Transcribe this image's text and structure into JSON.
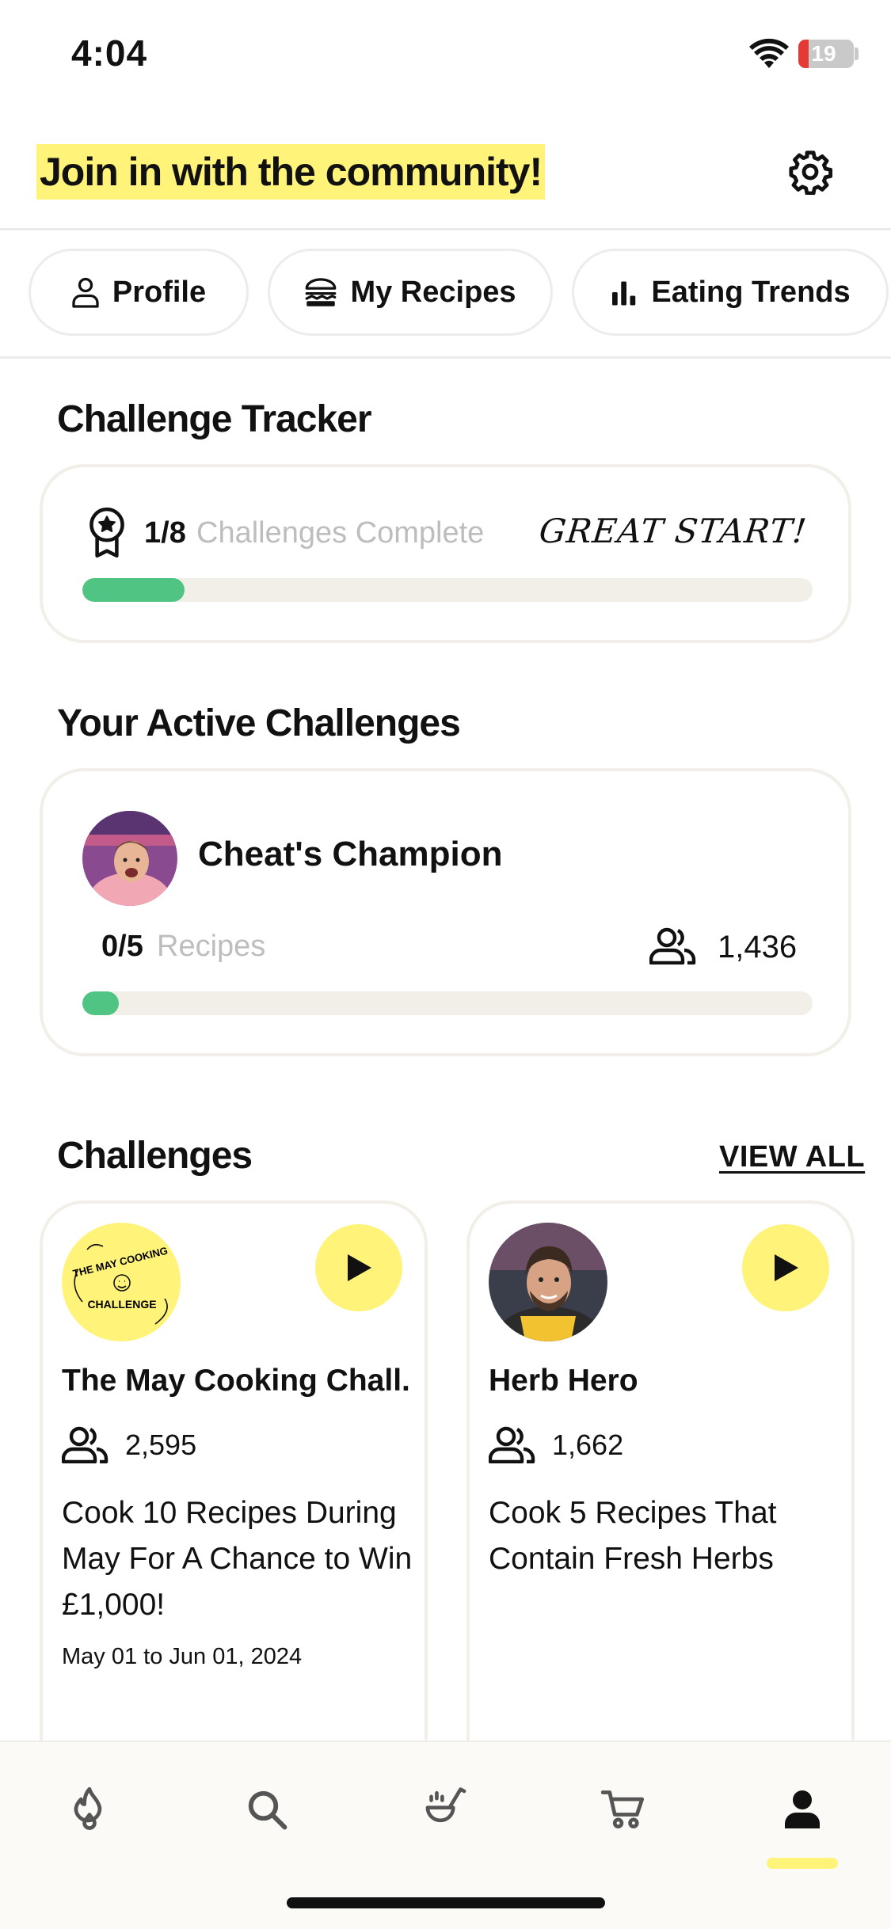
{
  "status_bar": {
    "time": "4:04",
    "battery": "19",
    "battery_level": 0.19
  },
  "header": {
    "title": "Join in with the community!"
  },
  "tabs": [
    {
      "label": "Profile",
      "icon": "person-icon"
    },
    {
      "label": "My Recipes",
      "icon": "burger-icon"
    },
    {
      "label": "Eating Trends",
      "icon": "bar-chart-icon"
    }
  ],
  "tracker": {
    "section_title": "Challenge Tracker",
    "count": "1/8",
    "label": "Challenges Complete",
    "praise": "GREAT START!",
    "progress": 0.14
  },
  "active": {
    "section_title": "Your Active Challenges",
    "name": "Cheat's Champion",
    "count": "0/5",
    "unit": "Recipes",
    "members": "1,436",
    "progress": 0.05
  },
  "challenges": {
    "section_title": "Challenges",
    "view_all": "VIEW ALL",
    "items": [
      {
        "title": "The May Cooking Chall...",
        "badge_top": "THE MAY COOKING",
        "badge_bottom": "CHALLENGE",
        "members": "2,595",
        "description": "Cook 10 Recipes During May For A Chance to Win £1,000!",
        "date": "May 01 to Jun 01, 2024"
      },
      {
        "title": "Herb Hero",
        "members": "1,662",
        "description": "Cook 5 Recipes That Contain Fresh Herbs",
        "date": ""
      }
    ]
  },
  "nav": {
    "items": [
      "flame-icon",
      "search-icon",
      "ladle-icon",
      "cart-icon",
      "profile-icon"
    ],
    "active": "profile-icon"
  },
  "colors": {
    "accent_yellow": "#fff37a",
    "progress_green": "#4fc483",
    "track_beige": "#f2efe9",
    "muted_text": "#bdbdbd"
  }
}
